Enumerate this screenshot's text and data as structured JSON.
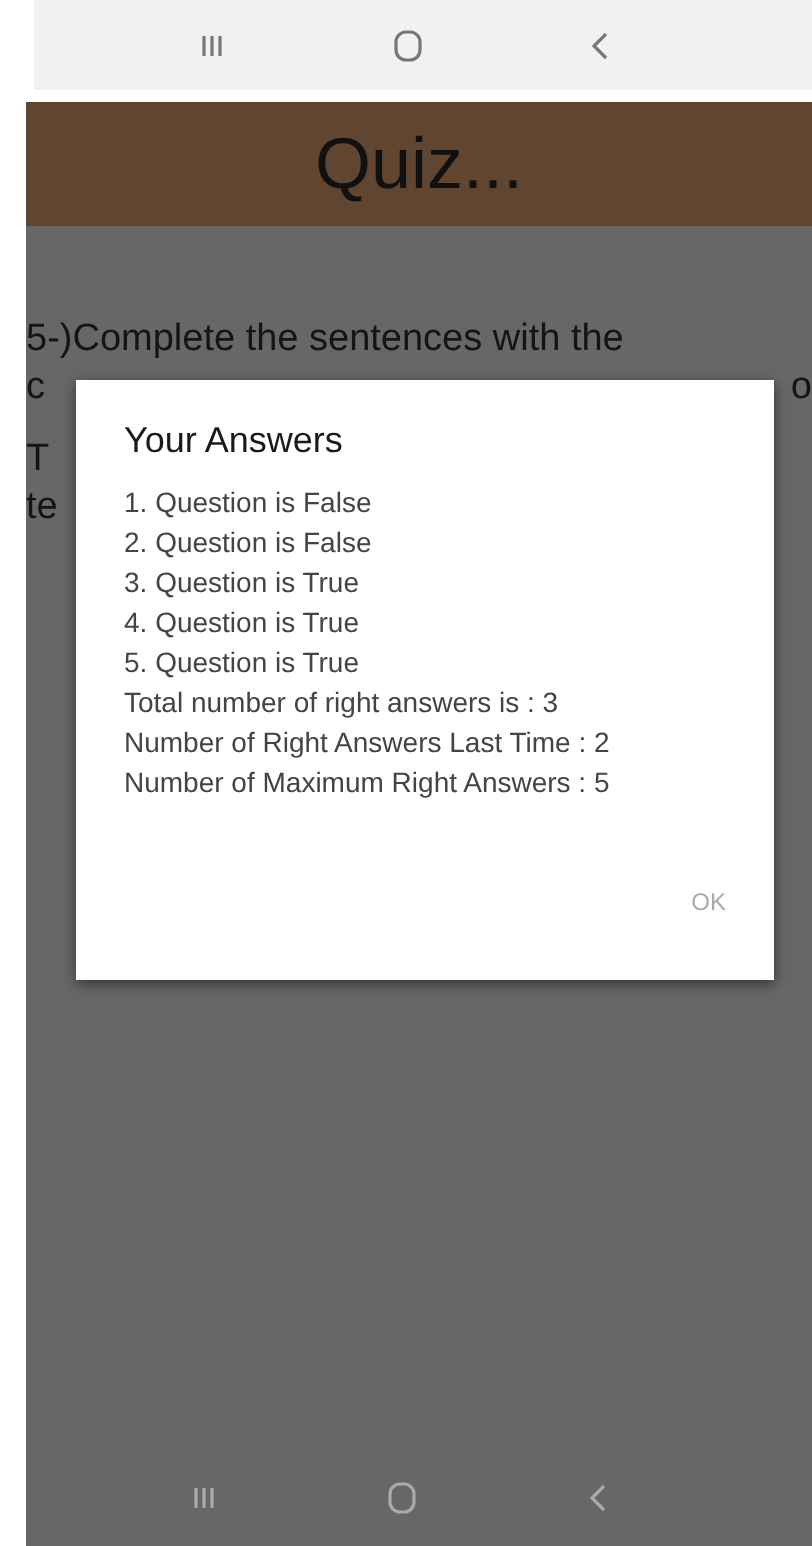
{
  "header": {
    "title": "Quiz..."
  },
  "question_lines": [
    {
      "left": "5-)Complete the sentences with the"
    },
    {
      "left": "c",
      "right": "o"
    },
    {
      "left": "T"
    },
    {
      "left": "te"
    }
  ],
  "dialog": {
    "title": "Your Answers",
    "lines": [
      "1. Question is False",
      "2. Question is False",
      "3. Question is True",
      "4. Question is True",
      "5. Question is True",
      "Total number of right answers is : 3",
      "Number of Right Answers Last Time : 2",
      "Number of Maximum Right Answers : 5"
    ],
    "button": "OK"
  }
}
